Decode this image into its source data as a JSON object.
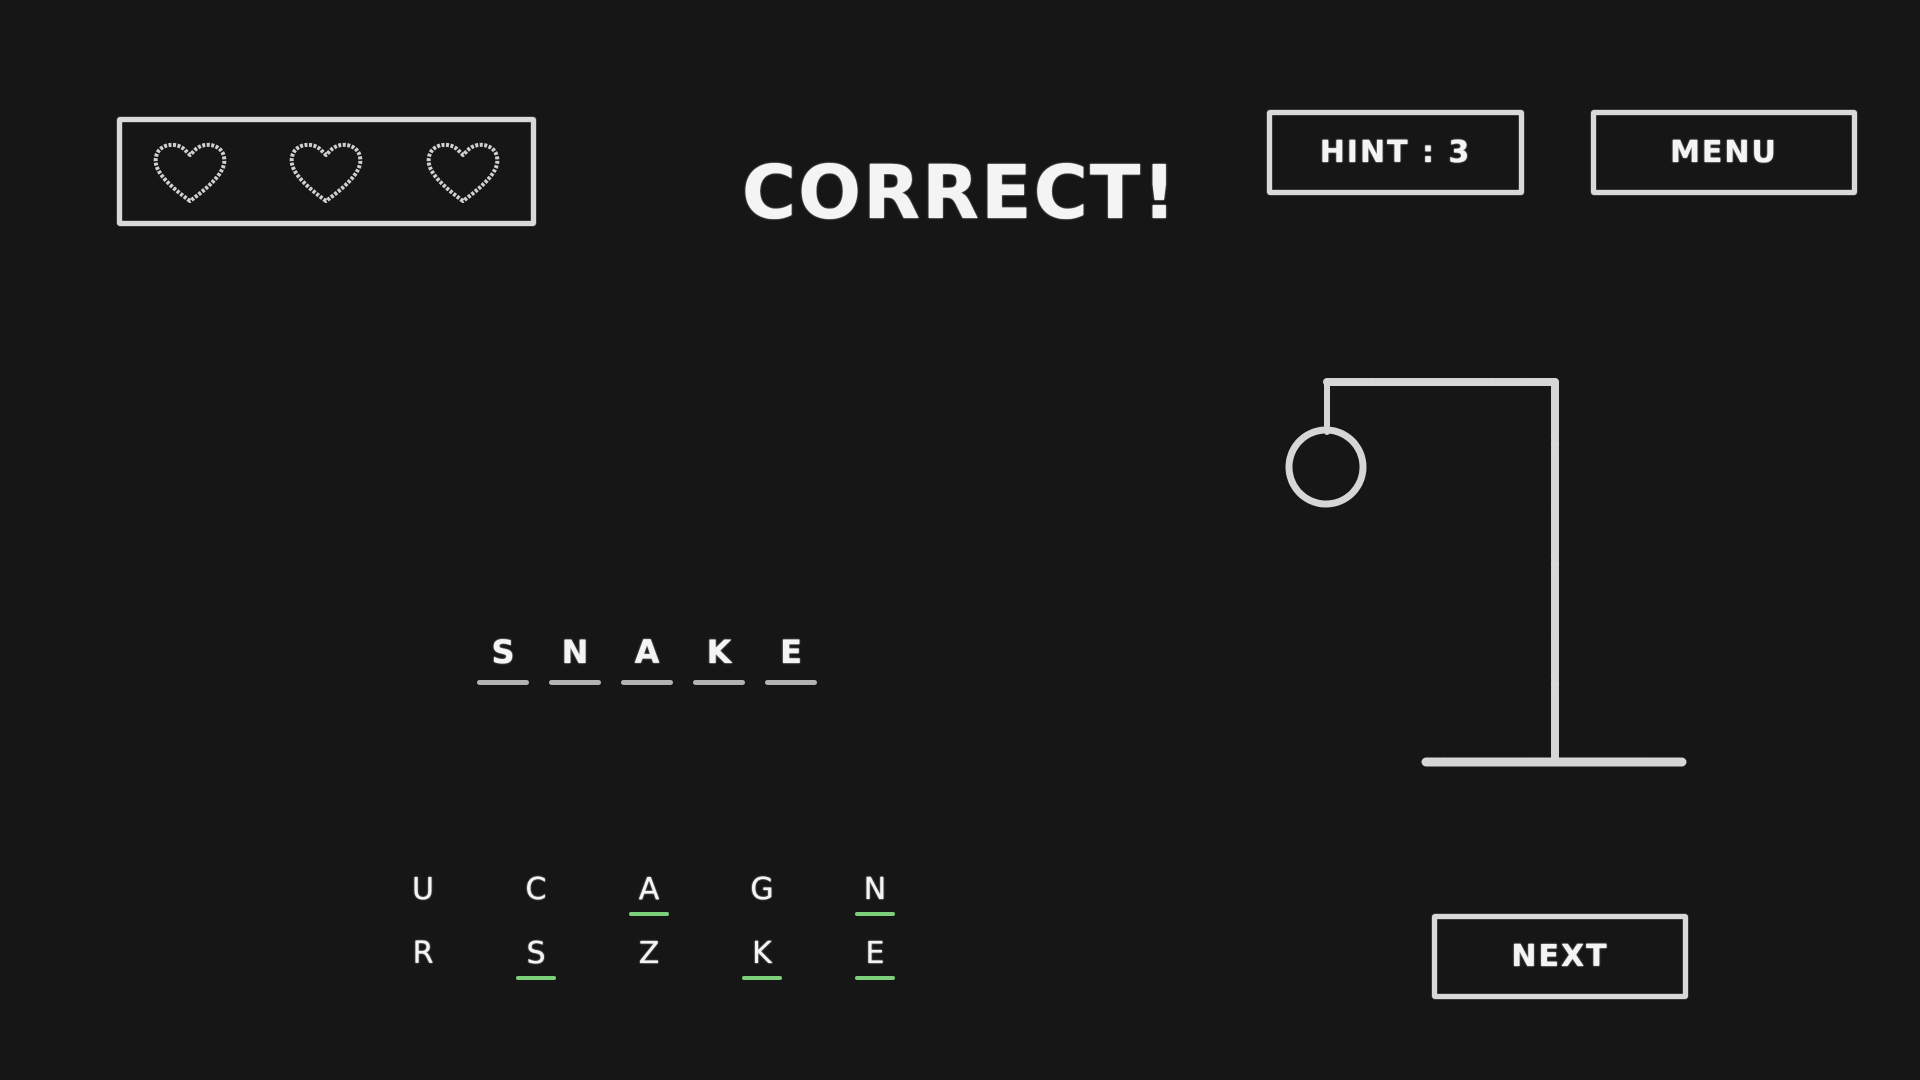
{
  "title": "CORRECT!",
  "lives": {
    "count": 3,
    "icon": "heart-icon",
    "color": "#d9d9d9"
  },
  "hint_button": {
    "label": "HINT : 3"
  },
  "menu_button": {
    "label": "MENU"
  },
  "next_button": {
    "label": "NEXT"
  },
  "word": {
    "letters": [
      "S",
      "N",
      "A",
      "K",
      "E"
    ]
  },
  "keyboard": {
    "correct_color": "#7cd07a",
    "keys": [
      {
        "letter": "U",
        "state": "unused"
      },
      {
        "letter": "C",
        "state": "unused"
      },
      {
        "letter": "A",
        "state": "correct"
      },
      {
        "letter": "G",
        "state": "unused"
      },
      {
        "letter": "N",
        "state": "correct"
      },
      {
        "letter": "R",
        "state": "unused"
      },
      {
        "letter": "S",
        "state": "correct"
      },
      {
        "letter": "Z",
        "state": "unused"
      },
      {
        "letter": "K",
        "state": "correct"
      },
      {
        "letter": "E",
        "state": "correct"
      }
    ]
  },
  "hangman": {
    "parts_drawn": [
      "gallows",
      "head"
    ]
  },
  "colors": {
    "background": "#161616",
    "chalk": "#f2f2f2"
  }
}
